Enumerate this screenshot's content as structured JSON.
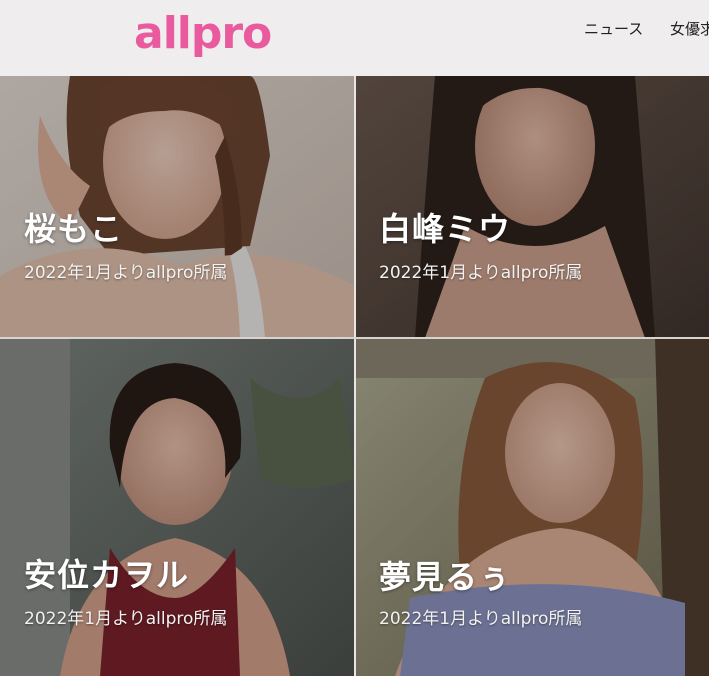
{
  "header": {
    "logo_text": "allpro",
    "logo_color": "#e95b9e",
    "nav": [
      {
        "label": "ニュース"
      },
      {
        "label": "女優求"
      }
    ]
  },
  "talents": [
    {
      "name": "桜もこ",
      "note": "2022年1月よりallpro所属"
    },
    {
      "name": "白峰ミウ",
      "note": "2022年1月よりallpro所属"
    },
    {
      "name": "安位カヲル",
      "note": "2022年1月よりallpro所属"
    },
    {
      "name": "夢見るぅ",
      "note": "2022年1月よりallpro所属"
    }
  ]
}
